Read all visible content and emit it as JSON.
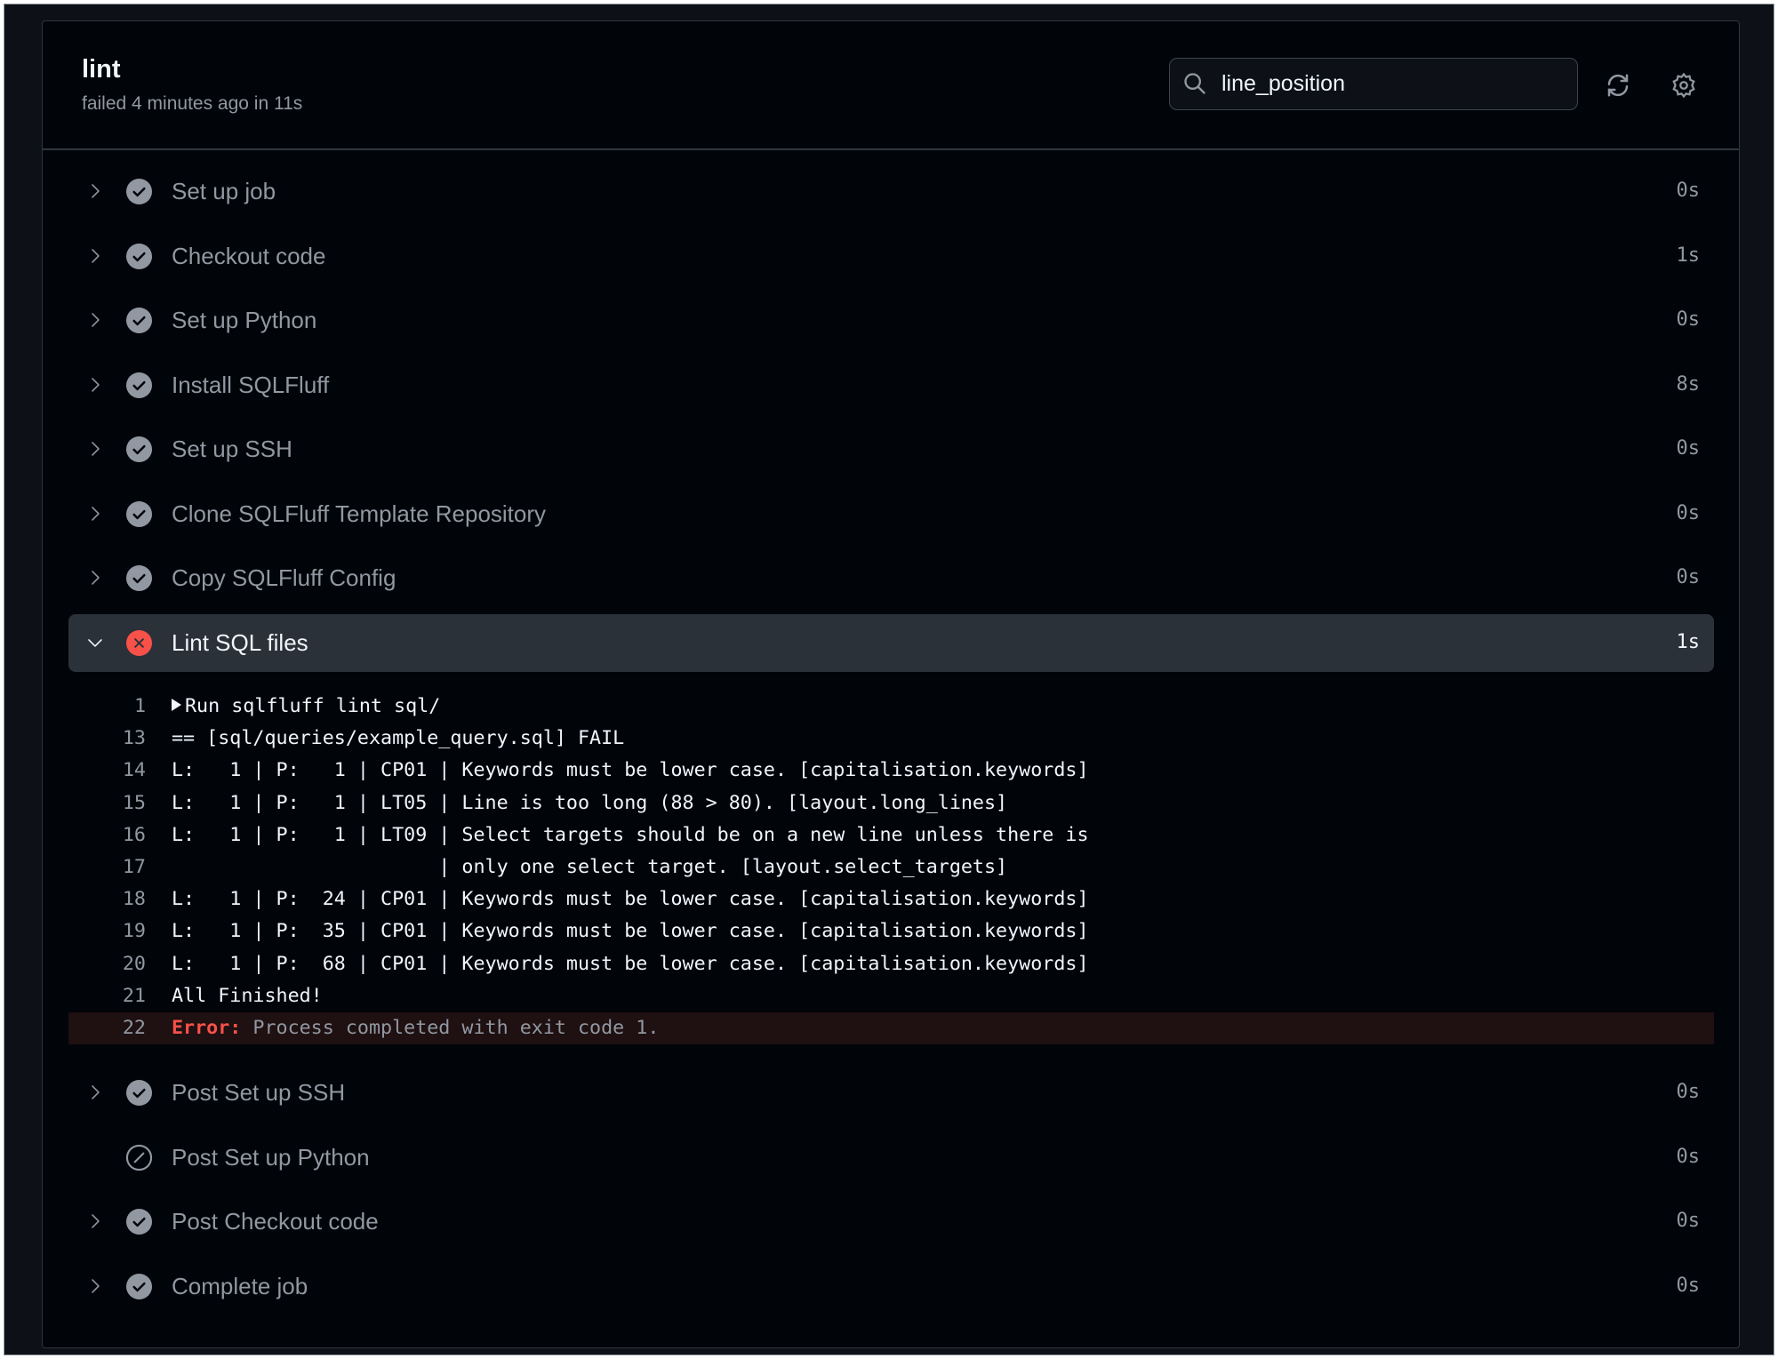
{
  "job": {
    "title": "lint",
    "status_text": "failed 4 minutes ago in 11s"
  },
  "search": {
    "value": "line_position",
    "icon": "search-icon"
  },
  "toolbar": {
    "refresh_icon": "sync-icon",
    "settings_icon": "gear-icon"
  },
  "colors": {
    "success": "#9198a1",
    "failure": "#f85149",
    "error_bg": "#1f1012",
    "highlight": "#2b3139"
  },
  "steps": [
    {
      "label": "Set up job",
      "duration": "0s",
      "status": "success",
      "expandable": true
    },
    {
      "label": "Checkout code",
      "duration": "1s",
      "status": "success",
      "expandable": true
    },
    {
      "label": "Set up Python",
      "duration": "0s",
      "status": "success",
      "expandable": true
    },
    {
      "label": "Install SQLFluff",
      "duration": "8s",
      "status": "success",
      "expandable": true
    },
    {
      "label": "Set up SSH",
      "duration": "0s",
      "status": "success",
      "expandable": true
    },
    {
      "label": "Clone SQLFluff Template Repository",
      "duration": "0s",
      "status": "success",
      "expandable": true
    },
    {
      "label": "Copy SQLFluff Config",
      "duration": "0s",
      "status": "success",
      "expandable": true
    },
    {
      "label": "Lint SQL files",
      "duration": "1s",
      "status": "failure",
      "expandable": true,
      "expanded": true,
      "log": [
        {
          "n": "1",
          "text": "Run sqlfluff lint sql/",
          "collapsible": true
        },
        {
          "n": "13",
          "text": "== [sql/queries/example_query.sql] FAIL"
        },
        {
          "n": "14",
          "text": "L:   1 | P:   1 | CP01 | Keywords must be lower case. [capitalisation.keywords]"
        },
        {
          "n": "15",
          "text": "L:   1 | P:   1 | LT05 | Line is too long (88 > 80). [layout.long_lines]"
        },
        {
          "n": "16",
          "text": "L:   1 | P:   1 | LT09 | Select targets should be on a new line unless there is"
        },
        {
          "n": "17",
          "text": "                       | only one select target. [layout.select_targets]"
        },
        {
          "n": "18",
          "text": "L:   1 | P:  24 | CP01 | Keywords must be lower case. [capitalisation.keywords]"
        },
        {
          "n": "19",
          "text": "L:   1 | P:  35 | CP01 | Keywords must be lower case. [capitalisation.keywords]"
        },
        {
          "n": "20",
          "text": "L:   1 | P:  68 | CP01 | Keywords must be lower case. [capitalisation.keywords]"
        },
        {
          "n": "21",
          "text": "All Finished!"
        },
        {
          "n": "22",
          "error_label": "Error:",
          "text": " Process completed with exit code 1.",
          "error": true
        }
      ]
    },
    {
      "label": "Post Set up SSH",
      "duration": "0s",
      "status": "success",
      "expandable": true
    },
    {
      "label": "Post Set up Python",
      "duration": "0s",
      "status": "skipped",
      "expandable": false
    },
    {
      "label": "Post Checkout code",
      "duration": "0s",
      "status": "success",
      "expandable": true
    },
    {
      "label": "Complete job",
      "duration": "0s",
      "status": "success",
      "expandable": true
    }
  ]
}
